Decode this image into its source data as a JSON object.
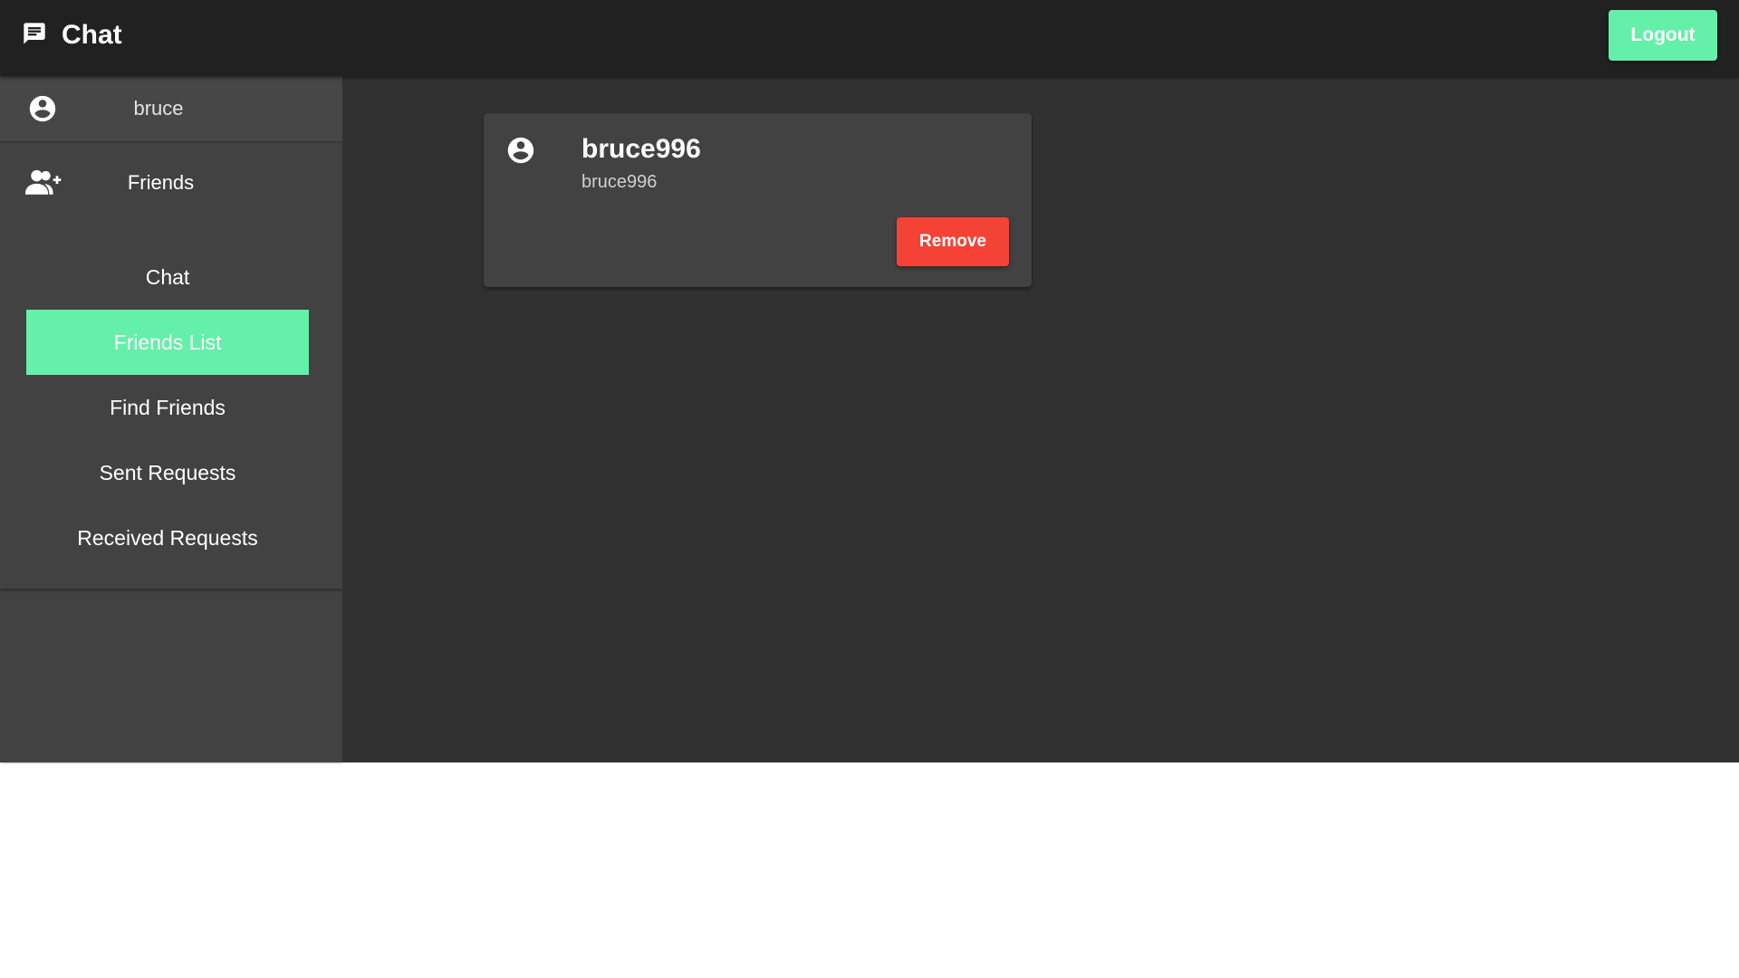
{
  "appbar": {
    "title": "Chat",
    "icon": "message-icon",
    "logout_label": "Logout"
  },
  "sidebar": {
    "user": {
      "name": "bruce",
      "icon": "account-circle-icon"
    },
    "section": {
      "label": "Friends",
      "icon": "person-add-icon"
    },
    "items": [
      {
        "label": "Chat",
        "active": false
      },
      {
        "label": "Friends List",
        "active": true
      },
      {
        "label": "Find Friends",
        "active": false
      },
      {
        "label": "Sent Requests",
        "active": false
      },
      {
        "label": "Received Requests",
        "active": false
      }
    ]
  },
  "friends": [
    {
      "title": "bruce996",
      "subtitle": "bruce996",
      "icon": "account-circle-icon",
      "remove_label": "Remove"
    }
  ],
  "colors": {
    "accent": "#64f0a9",
    "danger": "#f44336",
    "appbar": "#212121",
    "sidebar": "#424242",
    "background": "#313131",
    "card": "#424242"
  }
}
